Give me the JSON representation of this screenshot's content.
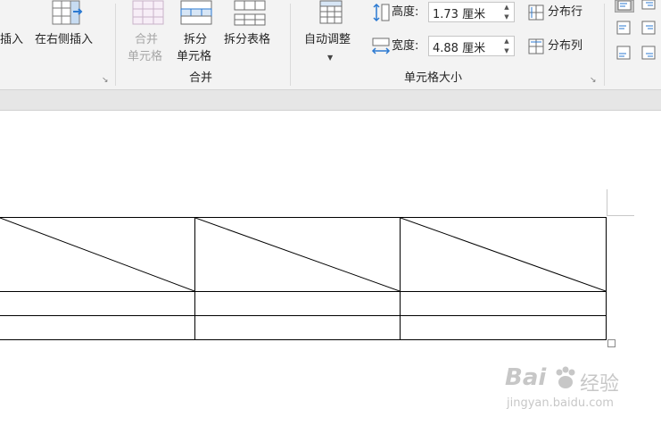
{
  "ribbon": {
    "insert_left_partial": "插入",
    "insert_right": "在右侧插入",
    "merge_cells_line1": "合并",
    "merge_cells_line2": "单元格",
    "split_cells_line1": "拆分",
    "split_cells_line2": "单元格",
    "split_table": "拆分表格",
    "merge_group": "合并",
    "autofit": "自动调整",
    "height_label": "高度:",
    "height_value": "1.73 厘米",
    "width_label": "宽度:",
    "width_value": "4.88 厘米",
    "distribute_rows": "分布行",
    "distribute_cols": "分布列",
    "cell_size_group": "单元格大小"
  },
  "colors": {
    "ribbon_bg": "#f3f3f3",
    "accent_blue": "#2b79d1",
    "disabled_text": "#a6a6a6",
    "table_border": "#000000"
  },
  "watermark": {
    "brand": "Bai",
    "brand_suffix": "经验",
    "url": "jingyan.baidu.com"
  }
}
